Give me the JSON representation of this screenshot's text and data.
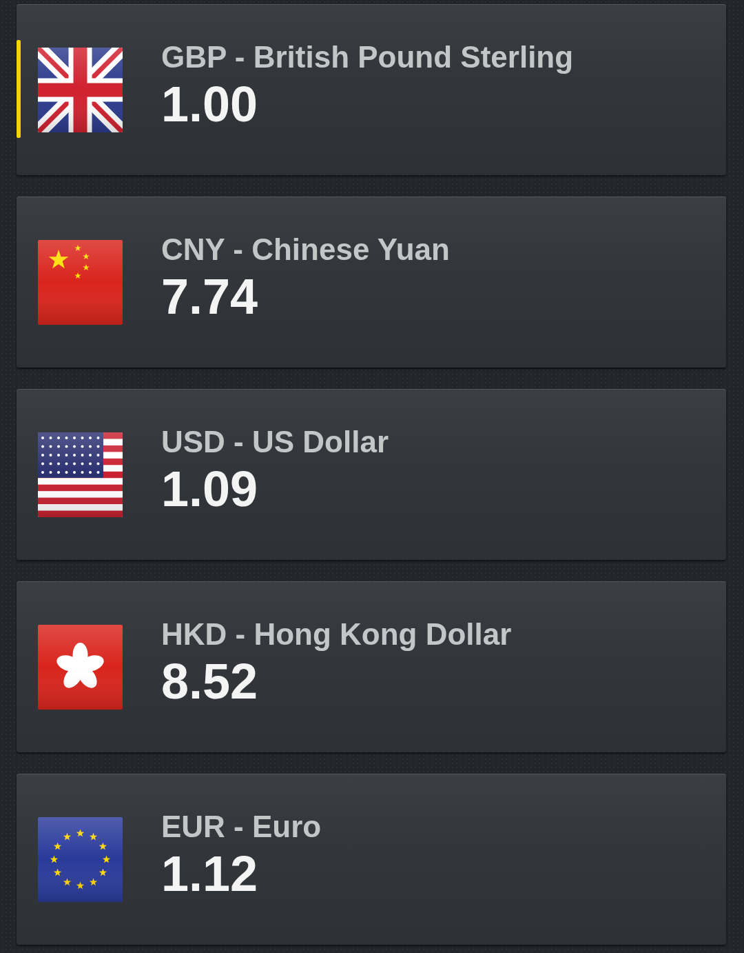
{
  "currencies": [
    {
      "name": "GBP - British Pound Sterling",
      "value": "1.00",
      "selected": true
    },
    {
      "name": "CNY - Chinese Yuan",
      "value": "7.74",
      "selected": false
    },
    {
      "name": "USD - US Dollar",
      "value": "1.09",
      "selected": false
    },
    {
      "name": "HKD - Hong Kong Dollar",
      "value": "8.52",
      "selected": false
    },
    {
      "name": "EUR - Euro",
      "value": "1.12",
      "selected": false
    }
  ]
}
